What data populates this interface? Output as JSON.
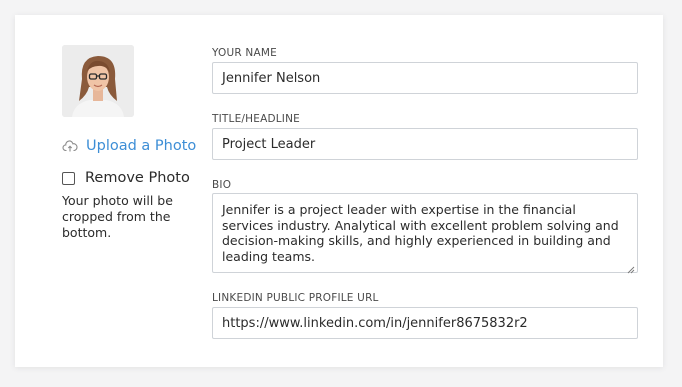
{
  "profile": {
    "upload_label": "Upload a Photo",
    "remove_label": "Remove Photo",
    "remove_checked": false,
    "note": "Your photo will be cropped from the bottom."
  },
  "fields": {
    "name_label": "YOUR NAME",
    "name_value": "Jennifer Nelson",
    "title_label": "TITLE/HEADLINE",
    "title_value": "Project Leader",
    "bio_label": "BIO",
    "bio_value": "Jennifer is a project leader with expertise in the financial services industry. Analytical with excellent problem solving and decision-making skills, and highly experienced in building and leading teams.",
    "linkedin_label": "LINKEDIN PUBLIC PROFILE URL",
    "linkedin_value": "https://www.linkedin.com/in/jennifer8675832r2"
  },
  "icons": {
    "upload": "cloud-upload-icon",
    "resize": "resize-handle-icon"
  },
  "colors": {
    "accent": "#3d8ed6",
    "border": "#cfd3d8"
  }
}
